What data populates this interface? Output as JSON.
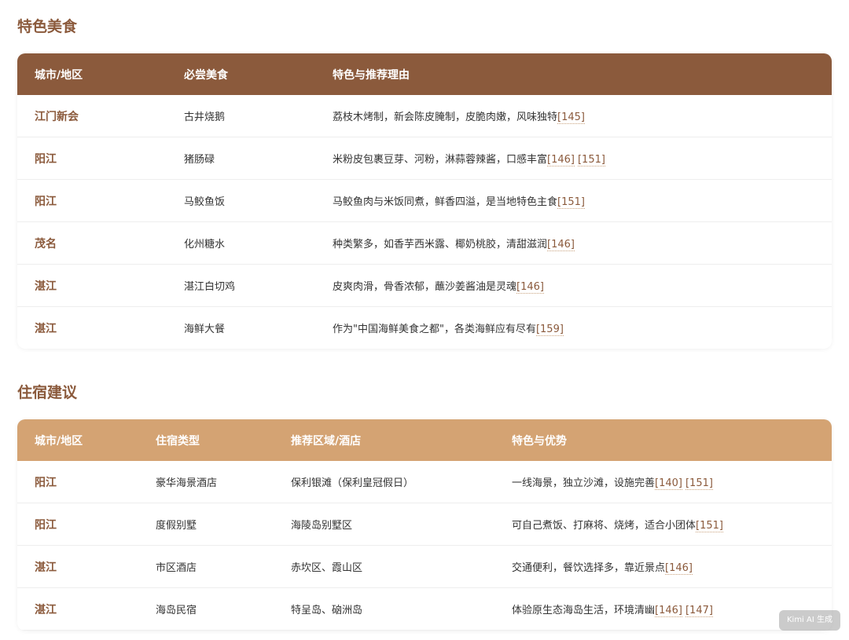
{
  "food_section": {
    "title": "特色美食",
    "headers": [
      "城市/地区",
      "必尝美食",
      "特色与推荐理由"
    ],
    "rows": [
      {
        "city": "江门新会",
        "item": "古井烧鹅",
        "desc": "荔枝木烤制，新会陈皮腌制，皮脆肉嫩，风味独特",
        "refs": [
          "[145]"
        ]
      },
      {
        "city": "阳江",
        "item": "猪肠碌",
        "desc": "米粉皮包裹豆芽、河粉，淋蒜蓉辣酱，口感丰富",
        "refs": [
          "[146]",
          "[151]"
        ]
      },
      {
        "city": "阳江",
        "item": "马鲛鱼饭",
        "desc": "马鲛鱼肉与米饭同煮，鲜香四溢，是当地特色主食",
        "refs": [
          "[151]"
        ]
      },
      {
        "city": "茂名",
        "item": "化州糖水",
        "desc": "种类繁多，如香芋西米露、椰奶桃胶，清甜滋润",
        "refs": [
          "[146]"
        ]
      },
      {
        "city": "湛江",
        "item": "湛江白切鸡",
        "desc": "皮爽肉滑，骨香浓郁，蘸沙姜酱油是灵魂",
        "refs": [
          "[146]"
        ]
      },
      {
        "city": "湛江",
        "item": "海鲜大餐",
        "desc": "作为\"中国海鲜美食之都\"，各类海鲜应有尽有",
        "refs": [
          "[159]"
        ]
      }
    ]
  },
  "stay_section": {
    "title": "住宿建议",
    "headers": [
      "城市/地区",
      "住宿类型",
      "推荐区域/酒店",
      "特色与优势"
    ],
    "rows": [
      {
        "city": "阳江",
        "type": "豪华海景酒店",
        "area": "保利银滩（保利皇冠假日）",
        "desc": "一线海景，独立沙滩，设施完善",
        "refs": [
          "[140]",
          "[151]"
        ]
      },
      {
        "city": "阳江",
        "type": "度假别墅",
        "area": "海陵岛别墅区",
        "desc": "可自己煮饭、打麻将、烧烤，适合小团体",
        "refs": [
          "[151]"
        ]
      },
      {
        "city": "湛江",
        "type": "市区酒店",
        "area": "赤坎区、霞山区",
        "desc": "交通便利，餐饮选择多，靠近景点",
        "refs": [
          "[146]"
        ]
      },
      {
        "city": "湛江",
        "type": "海岛民宿",
        "area": "特呈岛、硇洲岛",
        "desc": "体验原生态海岛生活，环境清幽",
        "refs": [
          "[146]",
          "[147]"
        ]
      }
    ]
  },
  "watermark": "Kimi AI 生成",
  "colors": {
    "primary_brown": "#8b5a3c",
    "light_tan": "#d4a373"
  }
}
